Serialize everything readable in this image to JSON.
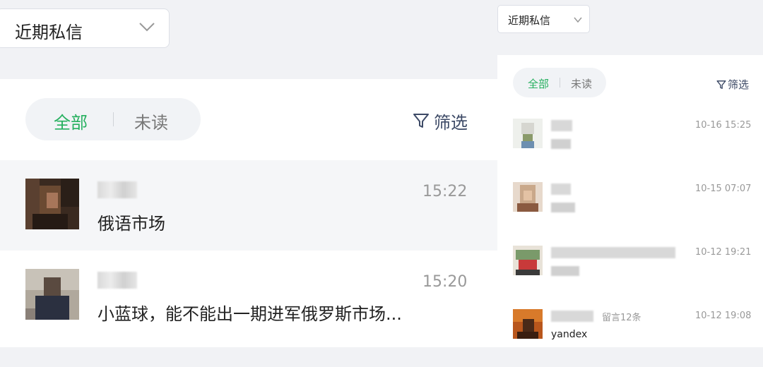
{
  "left": {
    "dropdown_label": "近期私信",
    "tabs": {
      "all": "全部",
      "unread": "未读"
    },
    "filter_label": "筛选",
    "messages": [
      {
        "time": "15:22",
        "text": "俄语市场"
      },
      {
        "time": "15:20",
        "text": "小蓝球，能不能出一期进军俄罗斯市场..."
      }
    ]
  },
  "right": {
    "dropdown_label": "近期私信",
    "tabs": {
      "all": "全部",
      "unread": "未读"
    },
    "filter_label": "筛选",
    "messages": [
      {
        "time": "10-16 15:25",
        "text": ""
      },
      {
        "time": "10-15 07:07",
        "text": ""
      },
      {
        "time": "10-12 19:21",
        "text": ""
      },
      {
        "time": "10-12 19:08",
        "badge": "留言12条",
        "text": "yandex"
      }
    ]
  },
  "colors": {
    "accent_green": "#26b05f",
    "filter_blue": "#3d4a66"
  }
}
